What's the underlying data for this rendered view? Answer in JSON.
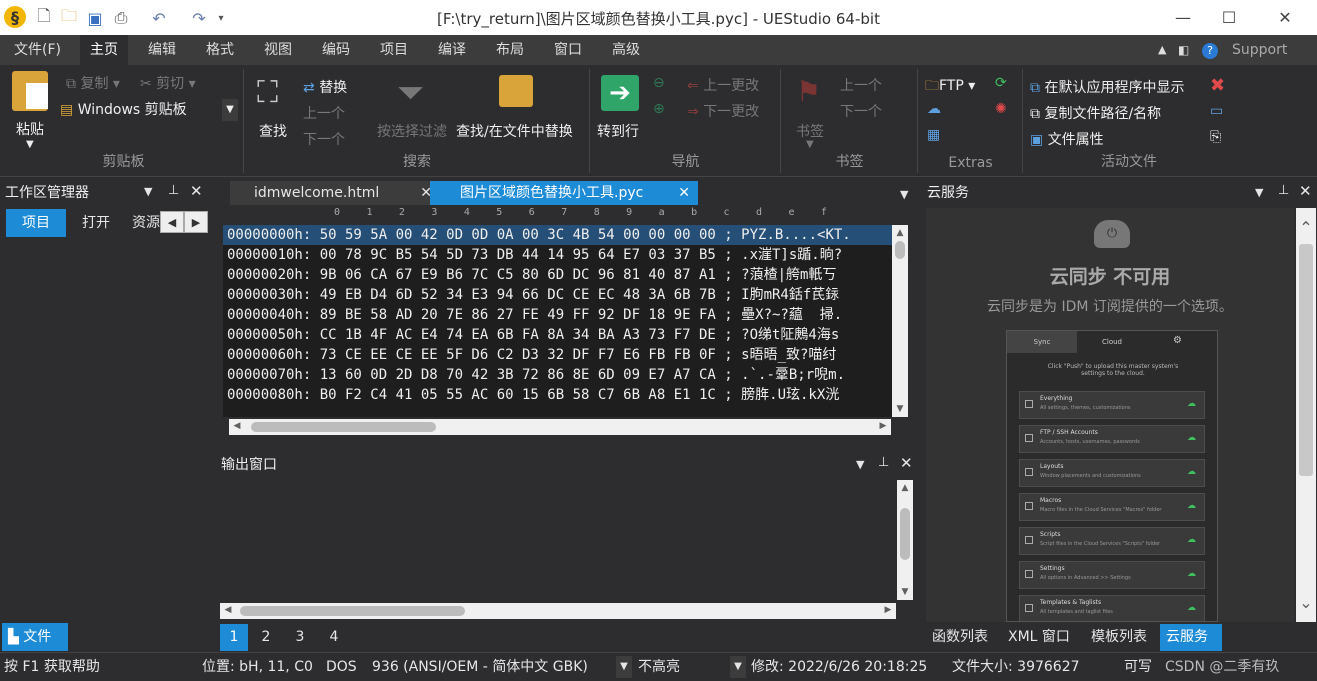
{
  "window": {
    "title": "[F:\\try_return]\\图片区域颜色替换小工具.pyc] - UEStudio 64-bit"
  },
  "menu": {
    "items": [
      "文件(F)",
      "主页",
      "编辑",
      "格式",
      "视图",
      "编码",
      "项目",
      "编译",
      "布局",
      "窗口",
      "高级"
    ],
    "support": "Support"
  },
  "ribbon": {
    "clipboard": {
      "paste": "粘贴",
      "copy": "复制",
      "cut": "剪切",
      "winclip": "Windows 剪贴板",
      "group": "剪贴板"
    },
    "search": {
      "find": "查找",
      "replace": "替换",
      "prev": "上一个",
      "next": "下一个",
      "filter": "按选择过滤",
      "findinfiles": "查找/在文件中替换",
      "group": "搜索"
    },
    "nav": {
      "goto": "转到行",
      "prevchange": "上一更改",
      "nextchange": "下一更改",
      "group": "导航"
    },
    "bookmark": {
      "bookmark": "书签",
      "prev": "上一个",
      "next": "下一个",
      "group": "书签"
    },
    "extras": {
      "ftp": "FTP",
      "group": "Extras"
    },
    "activefile": {
      "showdefault": "在默认应用程序中显示",
      "copypath": "复制文件路径/名称",
      "props": "文件属性",
      "group": "活动文件"
    }
  },
  "workspace": {
    "title": "工作区管理器",
    "tabs": [
      "项目",
      "打开",
      "资源"
    ],
    "bottom_tab": "文件"
  },
  "editor": {
    "tabs": [
      "idmwelcome.html",
      "图片区域颜色替换小工具.pyc"
    ],
    "ruler": "0  1  2  3  4  5  6  7  8  9  a  b  c  d  e  f",
    "rows": [
      "00000000h: 50 59 5A 00 42 0D 0D 0A 00 3C 4B 54 00 00 00 00 ; PYZ.B....<KT.",
      "00000010h: 00 78 9C B5 54 5D 73 DB 44 14 95 64 E7 03 37 B5 ; .x漄T]s踲.晌?",
      "00000020h: 9B 06 CA 67 E9 B6 7C C5 80 6D DC 96 81 40 87 A1 ; ?蒗楂|舿m軝丂",
      "00000030h: 49 EB D4 6D 52 34 E3 94 66 DC CE EC 48 3A 6B 7B ; I朐mR4銛f芪銢",
      "00000040h: 89 BE 58 AD 20 7E 86 27 FE 49 FF 92 DF 18 9E FA ; 壘X?~?藴  掃.",
      "00000050h: CC 1B 4F AC E4 74 EA 6B FA 8A 34 BA A3 73 F7 DE ; ?O绨t阷鶊4海s",
      "00000060h: 73 CE EE CE EE 5F D6 C2 D3 32 DF F7 E6 FB FB 0F ; s晤晤_致?喵纣",
      "00000070h: 13 60 0D 2D D8 70 42 3B 72 86 8E 6D 09 E7 A7 CA ; .`.-鞷B;r唲m.",
      "00000080h: B0 F2 C4 41 05 55 AC 60 15 6B 58 C7 6B A8 E1 1C ; 膀脌.U玹.kX洸"
    ]
  },
  "output": {
    "title": "输出窗口",
    "pages": [
      "1",
      "2",
      "3",
      "4"
    ]
  },
  "cloud": {
    "title": "云服务",
    "heading": "云同步 不可用",
    "desc": "云同步是为 IDM 订阅提供的一个选项。",
    "preview": {
      "tabs": [
        "Sync",
        "Cloud"
      ],
      "intro": "Click \"Push\" to upload this master system's settings to the cloud.",
      "items": [
        {
          "name": "Everything",
          "desc": "All settings, themes, customizations"
        },
        {
          "name": "FTP / SSH Accounts",
          "desc": "Accounts, hosts, usernames, passwords"
        },
        {
          "name": "Layouts",
          "desc": "Window placements and customizations"
        },
        {
          "name": "Macros",
          "desc": "Macro files in the Cloud Services \"Macros\" folder"
        },
        {
          "name": "Scripts",
          "desc": "Script files in the Cloud Services \"Scripts\" folder"
        },
        {
          "name": "Settings",
          "desc": "All options in Advanced >> Settings"
        },
        {
          "name": "Templates & Taglists",
          "desc": "All templates and taglist files"
        }
      ]
    },
    "bottom_tabs": [
      "函数列表",
      "XML 窗口",
      "模板列表",
      "云服务"
    ]
  },
  "status": {
    "help": "按 F1 获取帮助",
    "position": "位置: bH, 11, C0",
    "lineending": "DOS",
    "codepage": "936  (ANSI/OEM - 简体中文 GBK)",
    "highlight": "不高亮",
    "modified": "修改:  2022/6/26 20:18:25",
    "filesize": "文件大小:  3976627",
    "writable": "可写",
    "watermark": "CSDN @二季有玖"
  },
  "colors": {
    "accent": "#1e8bd6",
    "bg": "#2d2d30",
    "hexbg": "#1e1e1e"
  }
}
